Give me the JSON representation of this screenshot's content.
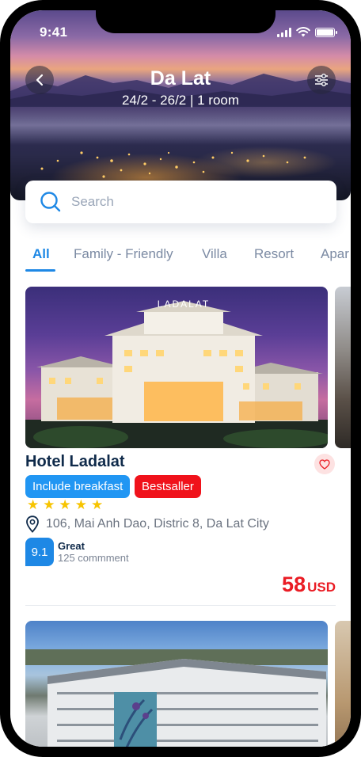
{
  "status_bar": {
    "time": "9:41"
  },
  "header": {
    "title": "Da Lat",
    "subtitle": "24/2 - 26/2 | 1 room"
  },
  "search": {
    "placeholder": "Search"
  },
  "tabs": [
    {
      "label": "All",
      "active": true
    },
    {
      "label": "Family - Friendly",
      "active": false
    },
    {
      "label": "Villa",
      "active": false
    },
    {
      "label": "Resort",
      "active": false
    },
    {
      "label": "Apar",
      "active": false
    }
  ],
  "hotels": [
    {
      "image_sign": "LADALAT",
      "name": "Hotel Ladalat",
      "badges": [
        {
          "label": "Include breakfast",
          "color": "#2196f3"
        },
        {
          "label": "Bestsaller",
          "color": "#f0121b"
        }
      ],
      "stars": 5,
      "address": "106, Mai Anh Dao, Distric 8, Da Lat City",
      "score": "9.1",
      "rating_word": "Great",
      "rating_count": "125 commment",
      "price": "58",
      "currency": "USD"
    }
  ],
  "colors": {
    "accent": "#1e88e5",
    "price": "#ea1c24",
    "star": "#f7c400",
    "title": "#0f2a4a"
  }
}
